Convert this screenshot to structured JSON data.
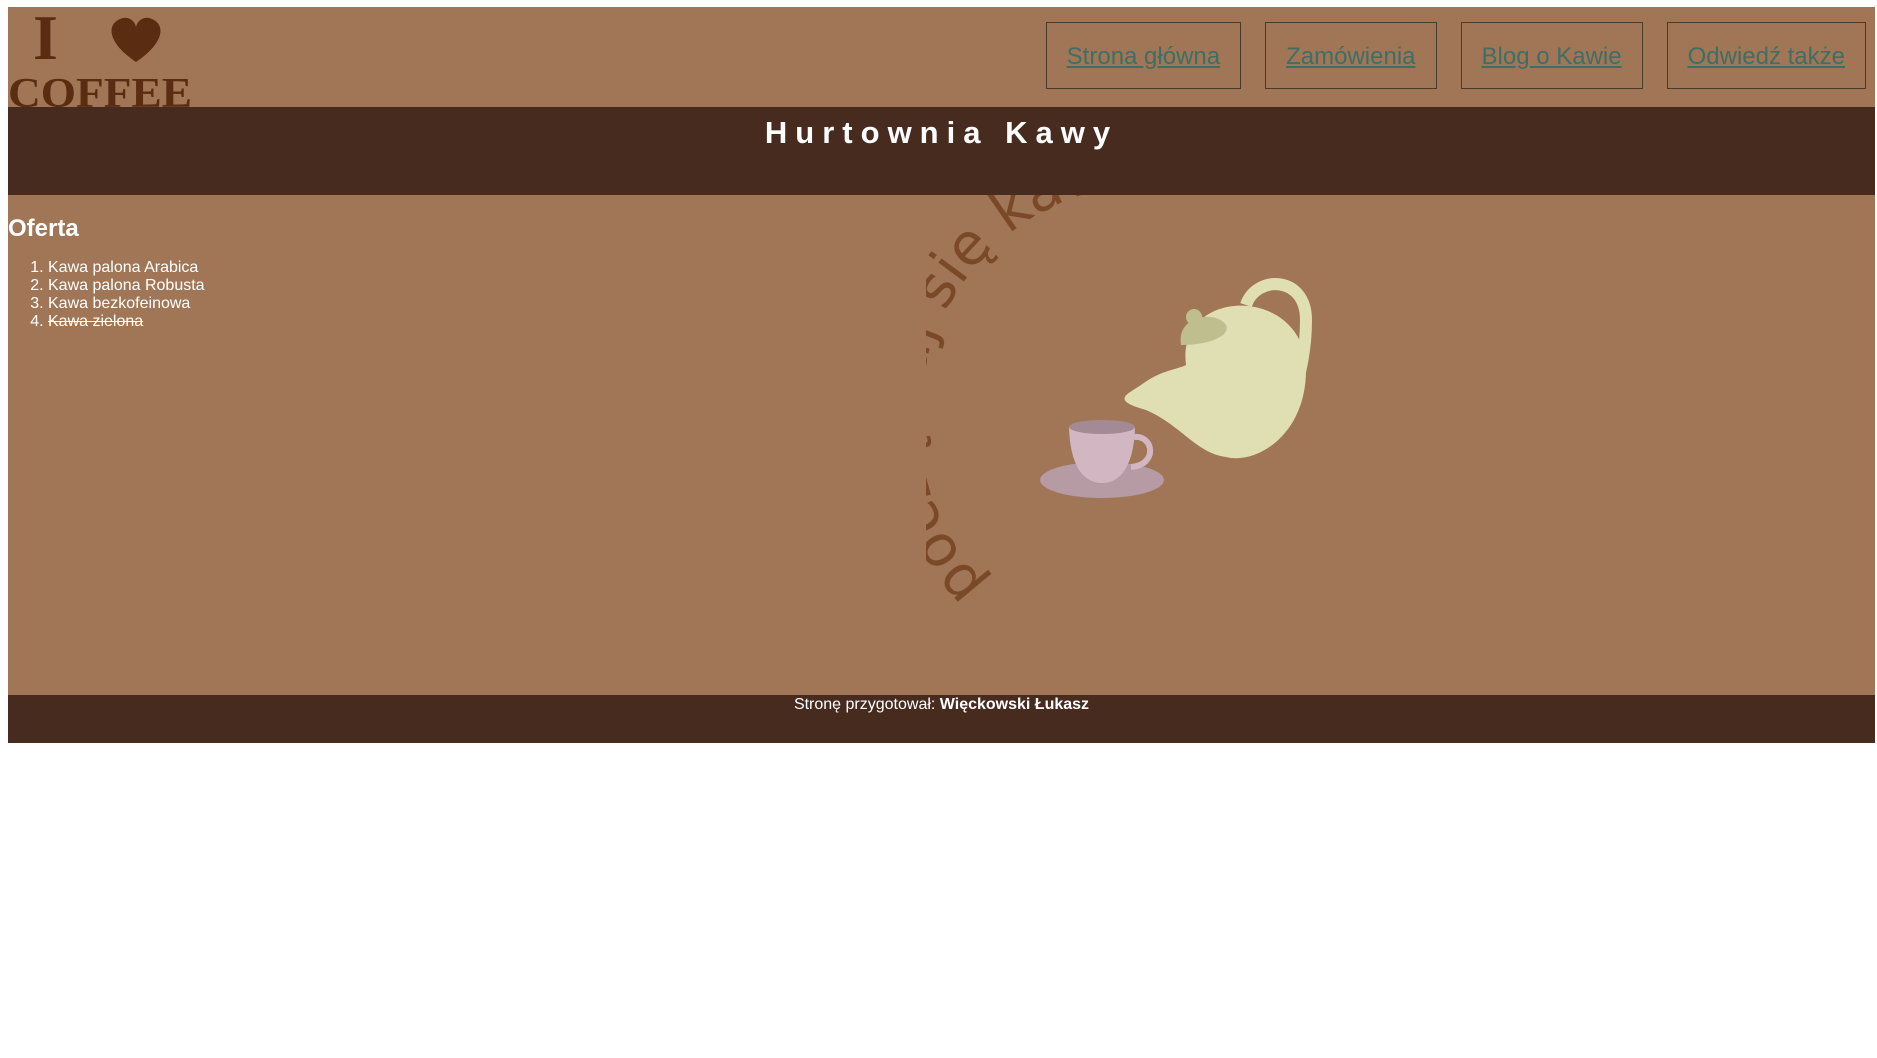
{
  "logo": {
    "line1": "I",
    "line2": "COFFEE",
    "icon": "heart-icon"
  },
  "nav": {
    "items": [
      {
        "label": "Strona główna"
      },
      {
        "label": "Zamówienia"
      },
      {
        "label": "Blog o Kawie"
      },
      {
        "label": "Odwiedź także"
      }
    ]
  },
  "banner": {
    "title": "Hurtownia Kawy"
  },
  "offer": {
    "heading": "Oferta",
    "items": [
      {
        "label": "Kawa palona Arabica"
      },
      {
        "label": "Kawa palona Robusta"
      },
      {
        "label": "Kawa bezkofeinowa"
      },
      {
        "label": "Kawa zielona",
        "struck": true
      }
    ]
  },
  "illustration": {
    "caption": "poczęstuj się kawą",
    "icons": [
      "teapot-icon",
      "cup-icon"
    ]
  },
  "footer": {
    "prefix": "Stronę przygotował:",
    "author": "Więckowski Łukasz"
  },
  "colors": {
    "brown_light": "#a07656",
    "brown_dark": "#472b1f",
    "link": "#3e6e64",
    "text_curve": "#7a4a28"
  }
}
